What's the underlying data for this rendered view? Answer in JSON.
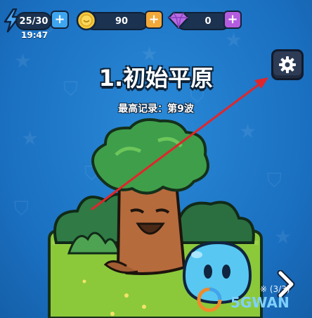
{
  "hud": {
    "energy": {
      "value": "25/30",
      "timer": "19:47",
      "icon": "lightning-icon",
      "add": "+"
    },
    "coins": {
      "value": "90",
      "icon": "coin-icon",
      "add": "+"
    },
    "gems": {
      "value": "0",
      "icon": "gem-icon",
      "add": "+"
    }
  },
  "settings": {
    "icon": "gear-icon"
  },
  "level": {
    "title": "1.初始平原",
    "record": "最高记录：第9波"
  },
  "watermark": {
    "brand": "5GWAN",
    "small": "※ (3/3)"
  },
  "colors": {
    "accent_blue": "#3ea5f0",
    "accent_orange": "#f3a93a",
    "accent_purple": "#b45ce0",
    "arrow_red": "#e0262b"
  }
}
